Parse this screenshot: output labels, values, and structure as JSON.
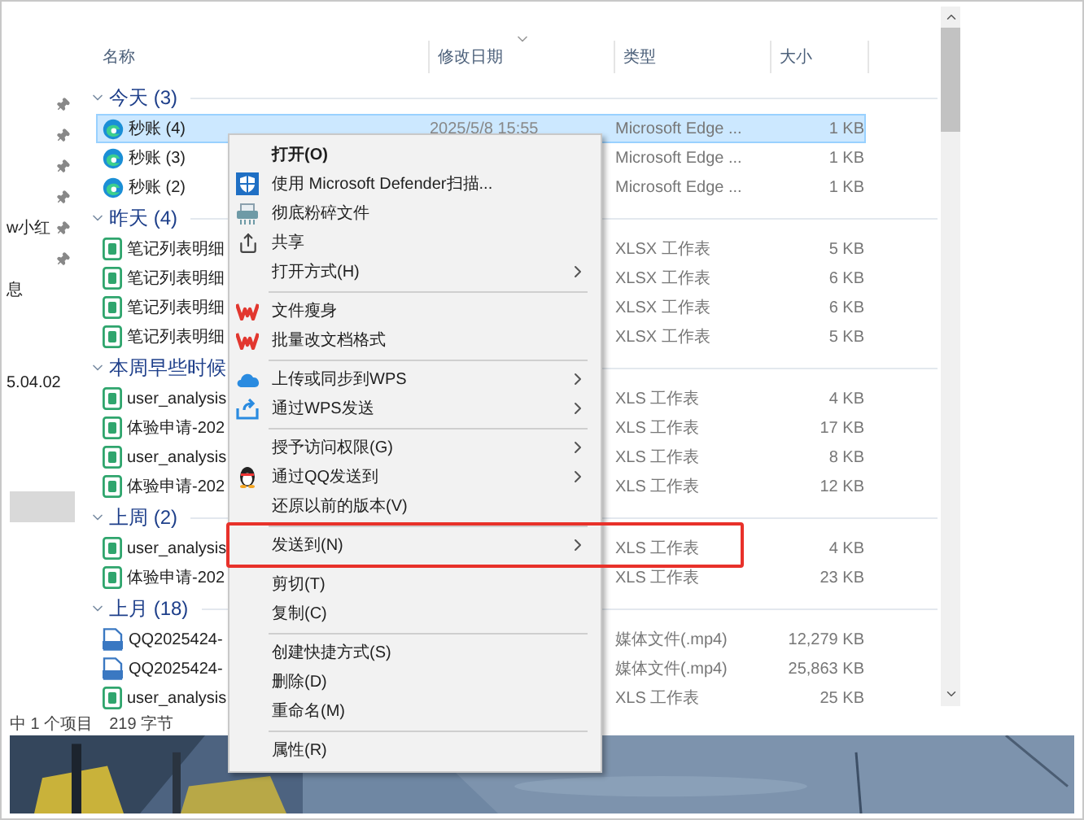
{
  "nav_pane": {
    "items": [
      {
        "pinned": true,
        "selected": false
      },
      {
        "pinned": true,
        "selected": false
      },
      {
        "pinned": true,
        "selected": false
      },
      {
        "pinned": true,
        "selected": false
      },
      {
        "label": "w小红",
        "pinned": true,
        "selected": false
      },
      {
        "pinned": true,
        "selected": false
      },
      {
        "label": "息",
        "pinned": false,
        "selected": false
      },
      {
        "pinned": false,
        "selected": false
      },
      {
        "pinned": false,
        "selected": false
      },
      {
        "label": "5.04.02",
        "pinned": false,
        "selected": false
      },
      {
        "pinned": false,
        "selected": false
      },
      {
        "pinned": false,
        "selected": false
      },
      {
        "pinned": false,
        "selected": false
      },
      {
        "pinned": false,
        "selected": true
      }
    ]
  },
  "file_list": {
    "columns": [
      "名称",
      "修改日期",
      "类型",
      "大小"
    ],
    "groups": [
      {
        "label": "今天 (3)",
        "expanded": true,
        "files": [
          {
            "name": "秒账 (4)",
            "kind": "edge",
            "date": "2025/5/8 15:55",
            "type": "Microsoft Edge ...",
            "size": "1 KB",
            "selected": true
          },
          {
            "name": "秒账 (3)",
            "kind": "edge",
            "type": "Microsoft Edge ...",
            "size": "1 KB",
            "selected": false
          },
          {
            "name": "秒账 (2)",
            "kind": "edge",
            "type": "Microsoft Edge ...",
            "size": "1 KB",
            "selected": false
          }
        ]
      },
      {
        "label": "昨天 (4)",
        "expanded": true,
        "files": [
          {
            "name": "笔记列表明细",
            "kind": "sheet",
            "type": "XLSX 工作表",
            "size": "5 KB",
            "selected": false
          },
          {
            "name": "笔记列表明细",
            "kind": "sheet",
            "type": "XLSX 工作表",
            "size": "6 KB",
            "selected": false
          },
          {
            "name": "笔记列表明细",
            "kind": "sheet",
            "type": "XLSX 工作表",
            "size": "6 KB",
            "selected": false
          },
          {
            "name": "笔记列表明细",
            "kind": "sheet",
            "type": "XLSX 工作表",
            "size": "5 KB",
            "selected": false
          }
        ]
      },
      {
        "label": "本周早些时候",
        "expanded": true,
        "files": [
          {
            "name": "user_analysis",
            "kind": "sheet",
            "type": "XLS 工作表",
            "size": "4 KB",
            "selected": false
          },
          {
            "name": "体验申请-202",
            "kind": "sheet",
            "type": "XLS 工作表",
            "size": "17 KB",
            "selected": false
          },
          {
            "name": "user_analysis",
            "kind": "sheet",
            "type": "XLS 工作表",
            "size": "8 KB",
            "selected": false
          },
          {
            "name": "体验申请-202",
            "kind": "sheet",
            "type": "XLS 工作表",
            "size": "12 KB",
            "selected": false
          }
        ]
      },
      {
        "label": "上周 (2)",
        "expanded": true,
        "files": [
          {
            "name": "user_analysis",
            "kind": "sheet",
            "type": "XLS 工作表",
            "size": "4 KB",
            "selected": false
          },
          {
            "name": "体验申请-202",
            "kind": "sheet",
            "type": "XLS 工作表",
            "size": "23 KB",
            "selected": false
          }
        ]
      },
      {
        "label": "上月 (18)",
        "expanded": true,
        "files": [
          {
            "name": "QQ2025424-",
            "kind": "video",
            "type": "媒体文件(.mp4)",
            "size": "12,279 KB",
            "selected": false
          },
          {
            "name": "QQ2025424-",
            "kind": "video",
            "type": "媒体文件(.mp4)",
            "size": "25,863 KB",
            "selected": false
          },
          {
            "name": "user_analysis",
            "kind": "sheet",
            "type": "XLS 工作表",
            "size": "25 KB",
            "selected": false
          }
        ]
      }
    ]
  },
  "status_bar": {
    "selection": "中 1 个项目",
    "size": "219 字节"
  },
  "context_menu": {
    "items": [
      {
        "kind": "plain",
        "label": "打开(O)",
        "bold": true,
        "submenu": false,
        "highlighted": false
      },
      {
        "kind": "shield",
        "label": "使用 Microsoft Defender扫描...",
        "bold": false,
        "submenu": false,
        "highlighted": false
      },
      {
        "kind": "shredder",
        "label": "彻底粉碎文件",
        "bold": false,
        "submenu": false,
        "highlighted": false
      },
      {
        "kind": "share",
        "label": "共享",
        "bold": false,
        "submenu": false,
        "highlighted": false
      },
      {
        "kind": "plain",
        "label": "打开方式(H)",
        "bold": false,
        "submenu": true,
        "highlighted": false
      },
      {
        "kind": "separator"
      },
      {
        "kind": "wps",
        "label": "文件瘦身",
        "bold": false,
        "submenu": false,
        "highlighted": false
      },
      {
        "kind": "wps",
        "label": "批量改文档格式",
        "bold": false,
        "submenu": false,
        "highlighted": false
      },
      {
        "kind": "separator"
      },
      {
        "kind": "cloud",
        "label": "上传或同步到WPS",
        "bold": false,
        "submenu": true,
        "highlighted": false
      },
      {
        "kind": "send",
        "label": "通过WPS发送",
        "bold": false,
        "submenu": true,
        "highlighted": false
      },
      {
        "kind": "separator"
      },
      {
        "kind": "plain",
        "label": "授予访问权限(G)",
        "bold": false,
        "submenu": true,
        "highlighted": false
      },
      {
        "kind": "penguin",
        "label": "通过QQ发送到",
        "bold": false,
        "submenu": true,
        "highlighted": false
      },
      {
        "kind": "plain",
        "label": "还原以前的版本(V)",
        "bold": false,
        "submenu": false,
        "highlighted": false
      },
      {
        "kind": "separator"
      },
      {
        "kind": "plain",
        "label": "发送到(N)",
        "bold": false,
        "submenu": true,
        "highlighted": true
      },
      {
        "kind": "separator"
      },
      {
        "kind": "plain",
        "label": "剪切(T)",
        "bold": false,
        "submenu": false,
        "highlighted": false
      },
      {
        "kind": "plain",
        "label": "复制(C)",
        "bold": false,
        "submenu": false,
        "highlighted": false
      },
      {
        "kind": "separator"
      },
      {
        "kind": "plain",
        "label": "创建快捷方式(S)",
        "bold": false,
        "submenu": false,
        "highlighted": false
      },
      {
        "kind": "plain",
        "label": "删除(D)",
        "bold": false,
        "submenu": false,
        "highlighted": false
      },
      {
        "kind": "plain",
        "label": "重命名(M)",
        "bold": false,
        "submenu": false,
        "highlighted": false
      },
      {
        "kind": "separator"
      },
      {
        "kind": "plain",
        "label": "属性(R)",
        "bold": false,
        "submenu": false,
        "highlighted": false
      }
    ]
  }
}
